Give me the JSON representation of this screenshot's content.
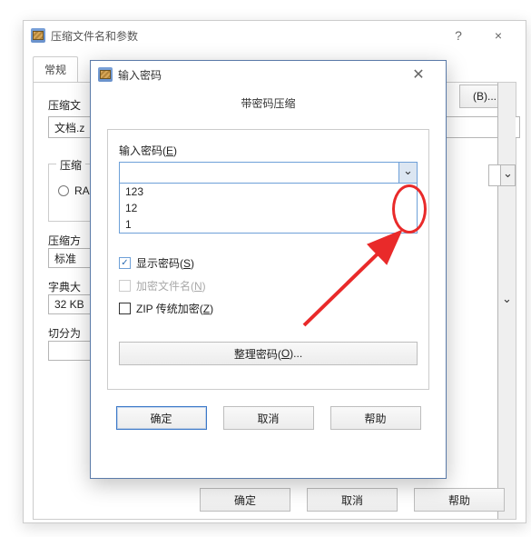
{
  "main": {
    "title": "压缩文件名和参数",
    "help_btn": "?",
    "close_btn": "×",
    "tab_general": "常规",
    "filename_label": "压缩文",
    "filename_value": "文档.z",
    "browse_label": "(B)...",
    "format_title": "压缩",
    "radio_rar": "RA",
    "method_label": "压缩方",
    "method_value": "标准",
    "dict_label": "字典大",
    "dict_value": "32 KB",
    "split_label": "切分为",
    "ok": "确定",
    "cancel": "取消",
    "help": "帮助"
  },
  "pw": {
    "title": "输入密码",
    "center_title": "带密码压缩",
    "input_label_pre": "输入密码(",
    "input_label_u": "E",
    "input_label_post": ")",
    "list": [
      "123",
      "12",
      "1"
    ],
    "show_pw_pre": "显示密码(",
    "show_pw_u": "S",
    "show_pw_post": ")",
    "encrypt_name_pre": "加密文件名(",
    "encrypt_name_u": "N",
    "encrypt_name_post": ")",
    "zip_legacy_pre": "ZIP 传统加密(",
    "zip_legacy_u": "Z",
    "zip_legacy_post": ")",
    "organize_pre": "整理密码(",
    "organize_u": "O",
    "organize_post": ")...",
    "ok": "确定",
    "cancel": "取消",
    "help": "帮助"
  }
}
